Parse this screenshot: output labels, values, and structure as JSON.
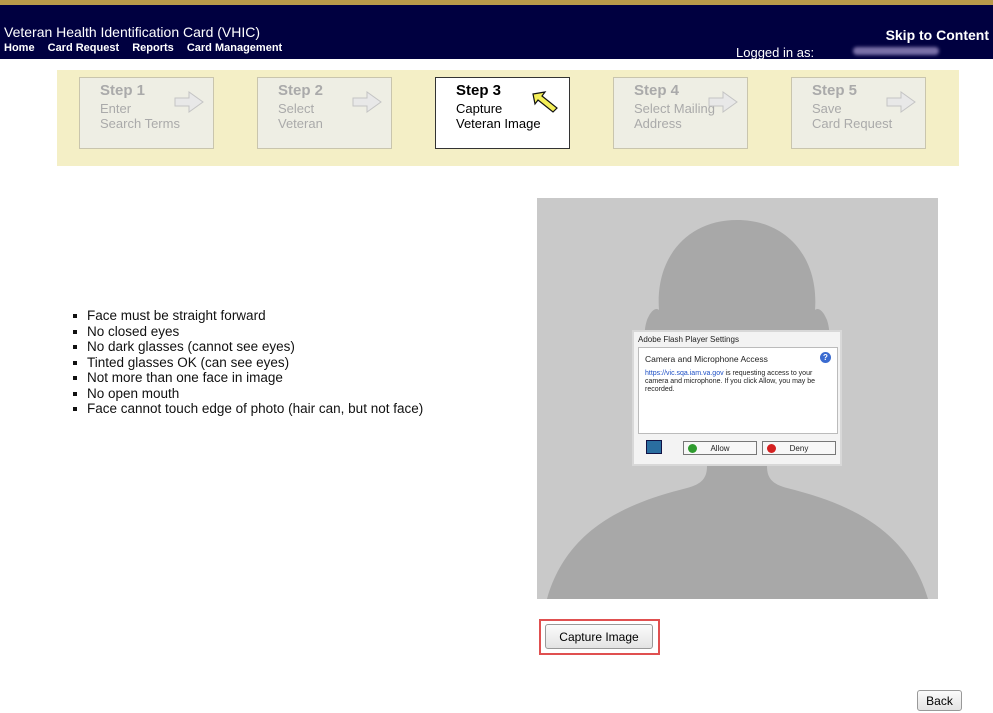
{
  "header": {
    "title": "Veteran Health Identification Card (VHIC)",
    "nav": [
      "Home",
      "Card Request",
      "Reports",
      "Card Management"
    ],
    "skip_link": "Skip to Content",
    "logged_in_label": "Logged in as:",
    "bar_color": "#000040",
    "trim_color": "#b89a4a"
  },
  "steps": [
    {
      "title": "Step 1",
      "line1": "Enter",
      "line2": "Search Terms",
      "active": false
    },
    {
      "title": "Step 2",
      "line1": "Select",
      "line2": "Veteran",
      "active": false
    },
    {
      "title": "Step 3",
      "line1": "Capture",
      "line2": "Veteran Image",
      "active": true
    },
    {
      "title": "Step 4",
      "line1": "Select Mailing",
      "line2": "Address",
      "active": false
    },
    {
      "title": "Step 5",
      "line1": "Save",
      "line2": "Card Request",
      "active": false
    }
  ],
  "guidelines": [
    "Face must be straight forward",
    "No closed eyes",
    "No dark glasses (cannot see eyes)",
    "Tinted glasses OK (can see eyes)",
    "Not more than one face in image",
    "No open mouth",
    "Face cannot touch edge of photo (hair can, but not face)"
  ],
  "flash_dialog": {
    "title": "Adobe Flash Player Settings",
    "heading": "Camera and Microphone Access",
    "link_text": "https://vic.sqa.iam.va.gov",
    "message": " is requesting access to your camera and microphone. If you click Allow, you may be recorded.",
    "allow_label": "Allow",
    "deny_label": "Deny"
  },
  "buttons": {
    "capture": "Capture Image",
    "back": "Back"
  }
}
